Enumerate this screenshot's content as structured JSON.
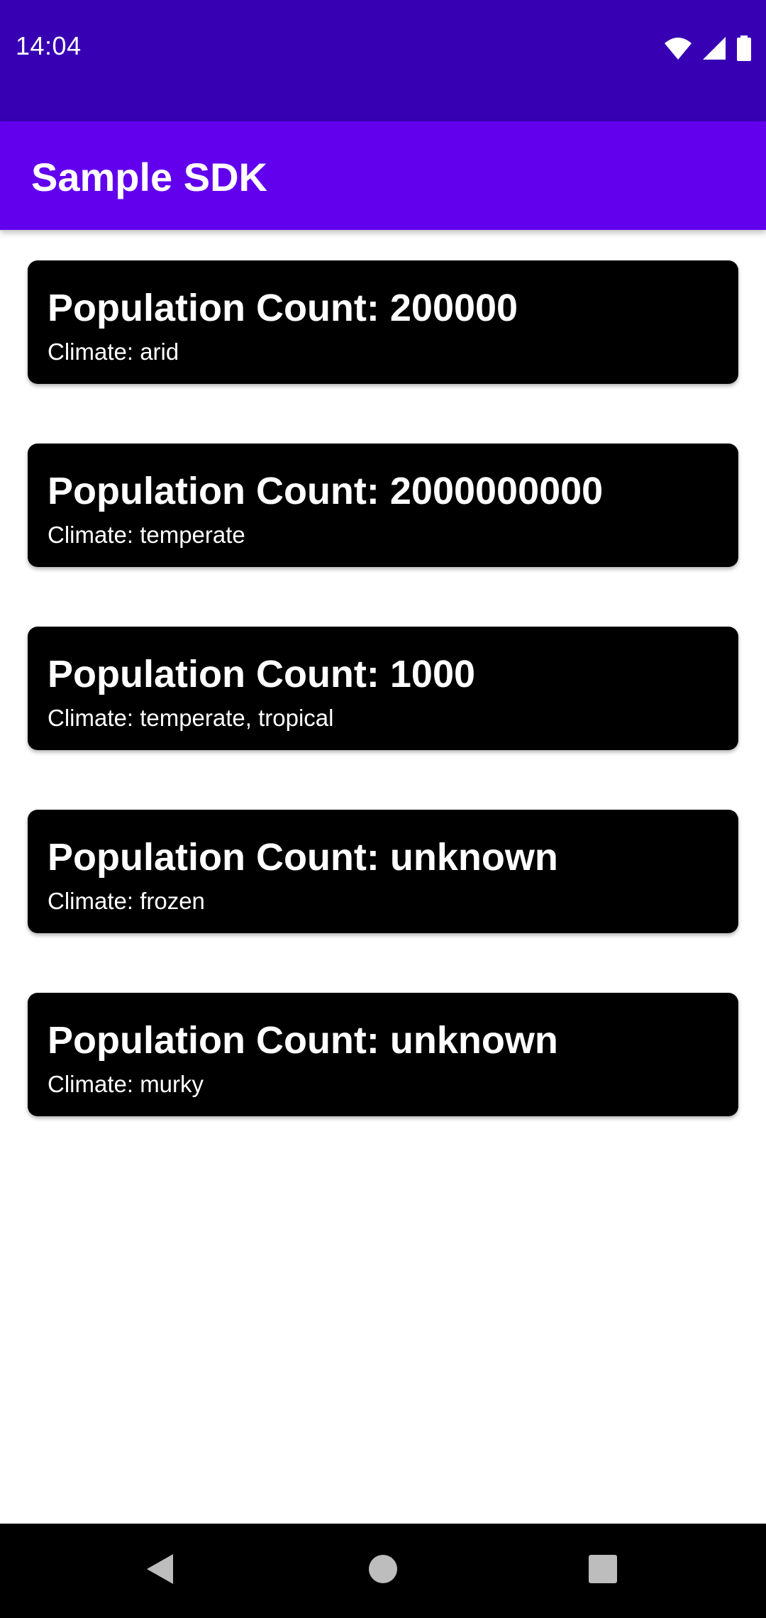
{
  "status_bar": {
    "time": "14:04",
    "icons": [
      "wifi-icon",
      "signal-icon",
      "battery-icon"
    ],
    "background": "#3700b3"
  },
  "app_bar": {
    "title": "Sample SDK",
    "background": "#6200ee"
  },
  "planets": [
    {
      "population": "Population Count: 200000",
      "climate": "Climate: arid"
    },
    {
      "population": "Population Count: 2000000000",
      "climate": "Climate: temperate"
    },
    {
      "population": "Population Count: 1000",
      "climate": "Climate: temperate, tropical"
    },
    {
      "population": "Population Count: unknown",
      "climate": "Climate: frozen"
    },
    {
      "population": "Population Count: unknown",
      "climate": "Climate: murky"
    }
  ],
  "nav_bar": {
    "buttons": [
      "back-icon",
      "home-icon",
      "recents-icon"
    ]
  }
}
